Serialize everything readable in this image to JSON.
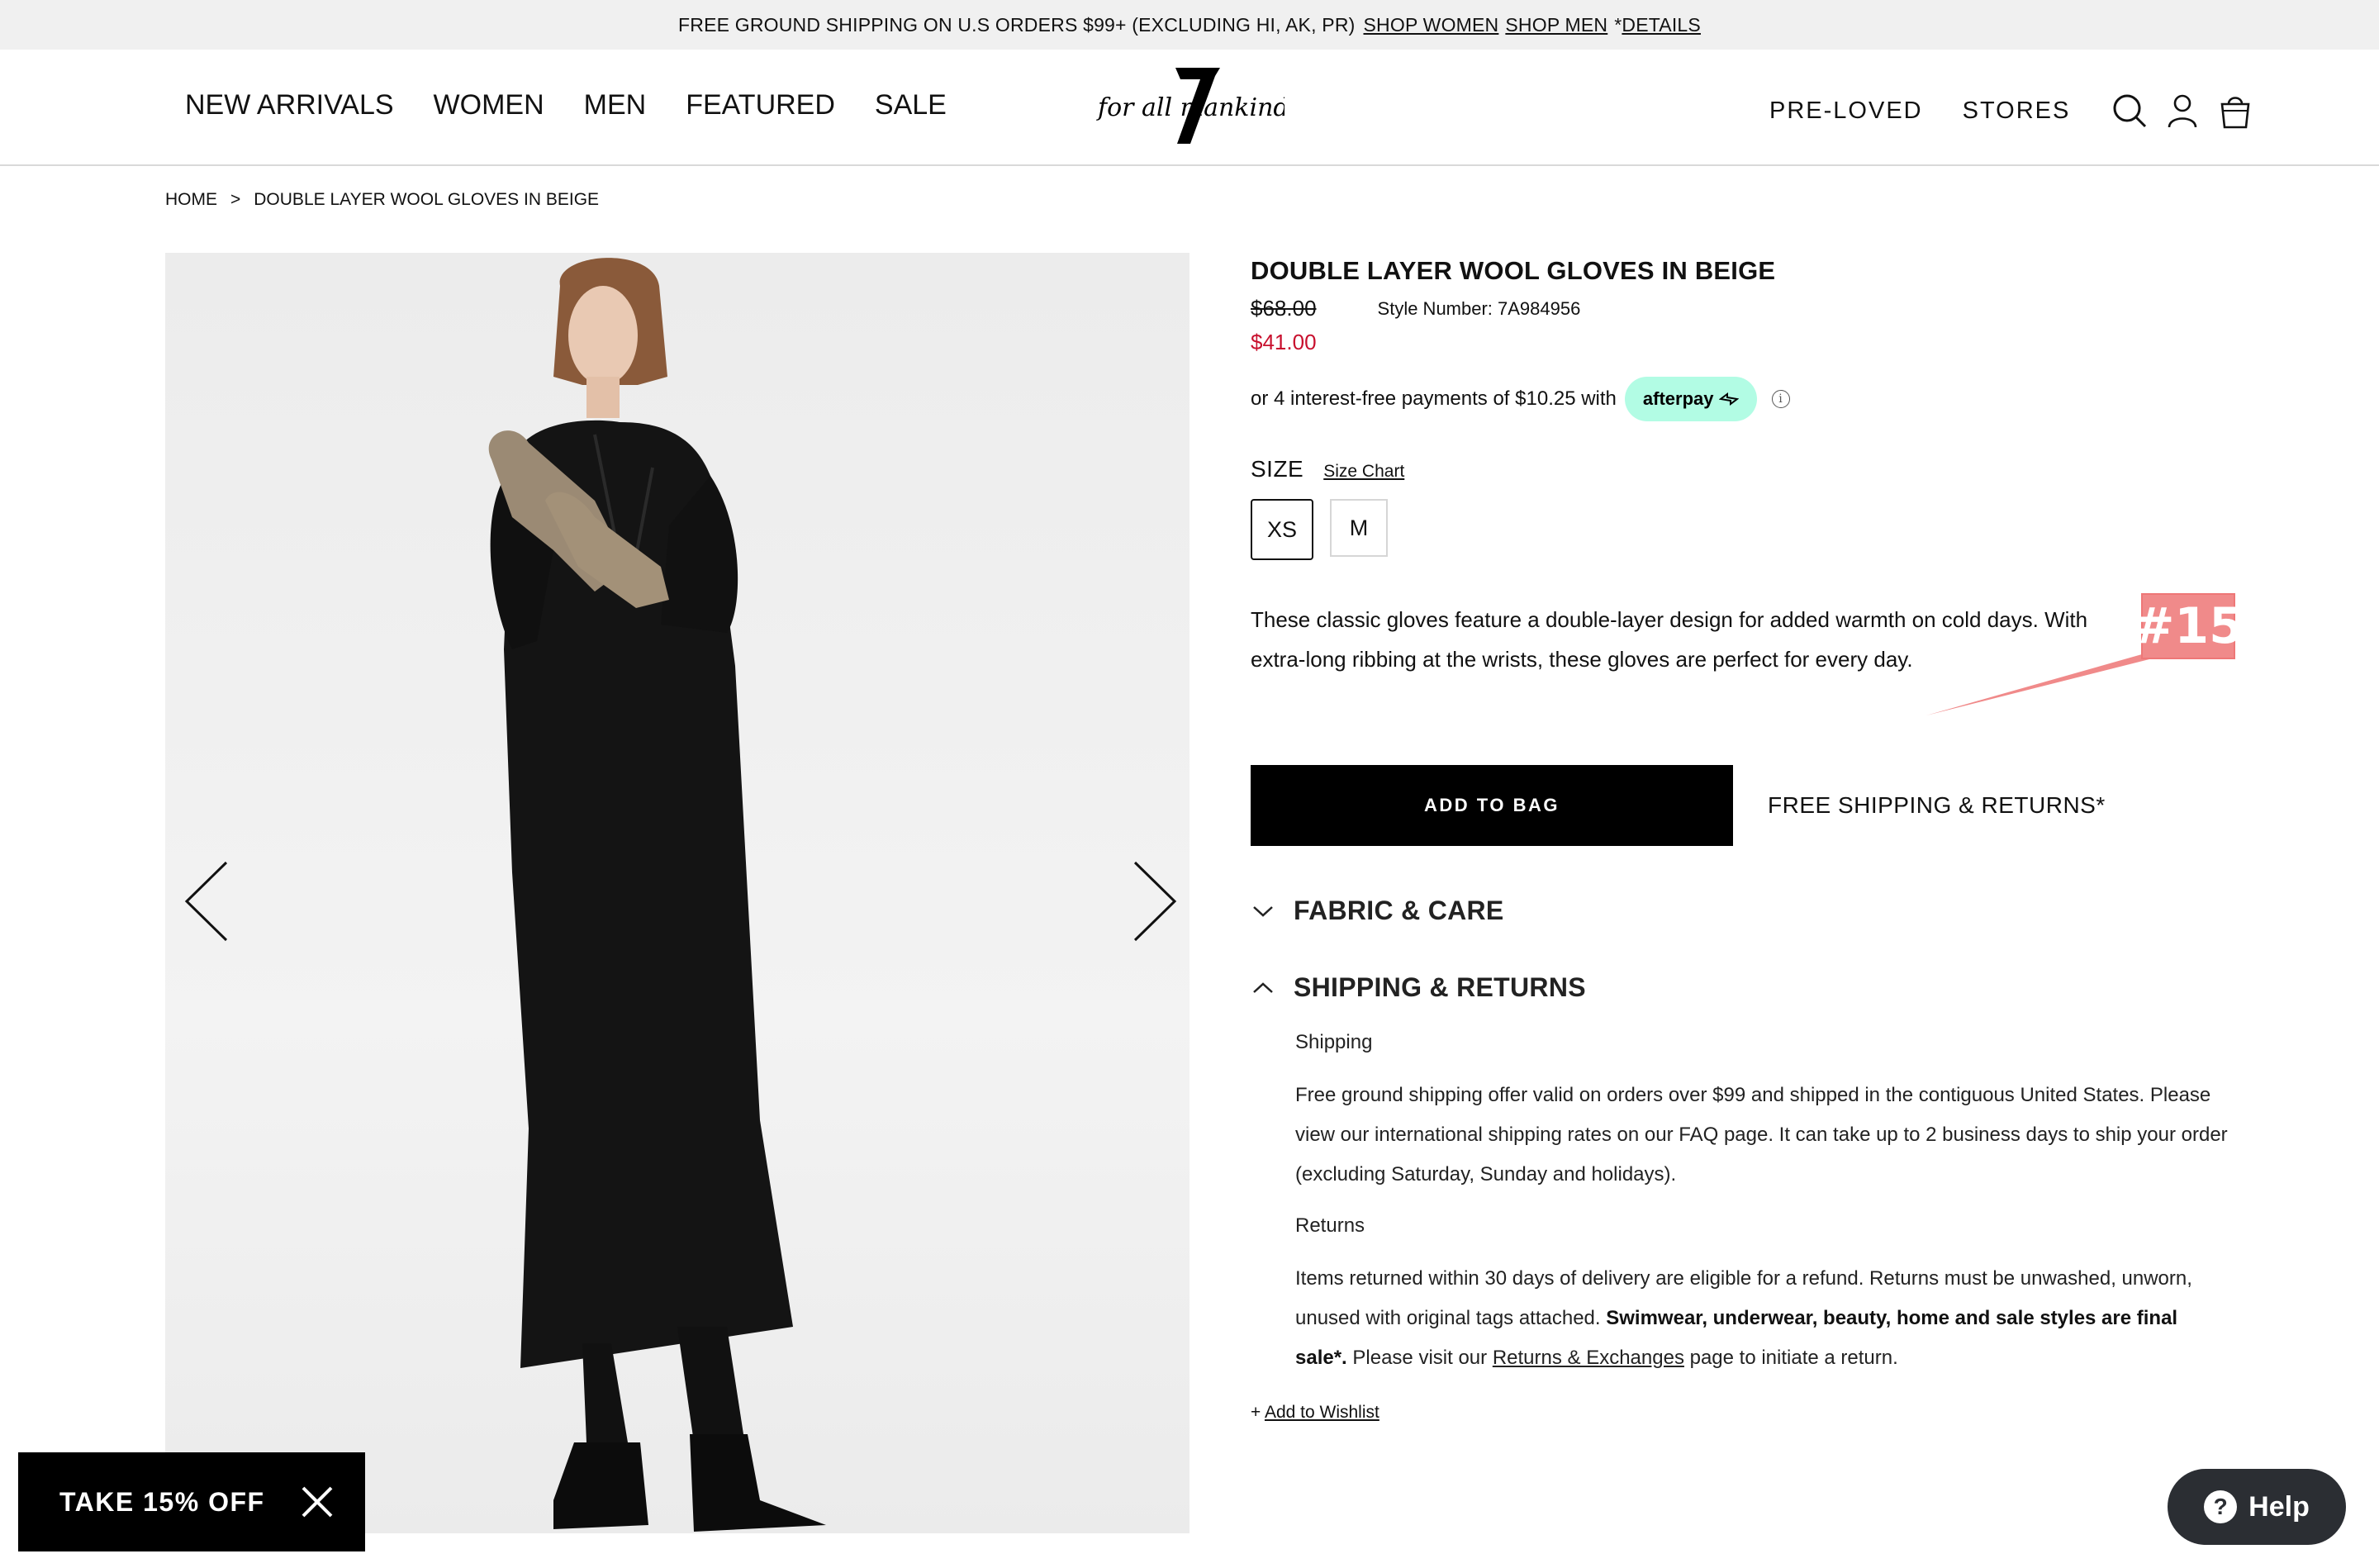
{
  "promo_bar": {
    "text": "FREE GROUND SHIPPING ON U.S ORDERS $99+ (EXCLUDING HI, AK, PR)",
    "shop_women": "SHOP WOMEN",
    "shop_men": "SHOP MEN",
    "details_prefix": "*",
    "details": "DETAILS"
  },
  "header": {
    "nav": [
      "NEW ARRIVALS",
      "WOMEN",
      "MEN",
      "FEATURED",
      "SALE"
    ],
    "logo_text": "for all mankind",
    "right_nav": [
      "PRE-LOVED",
      "STORES"
    ],
    "icons": [
      "search-icon",
      "account-icon",
      "bag-icon"
    ]
  },
  "breadcrumb": {
    "home": "HOME",
    "separator": ">",
    "current": "DOUBLE LAYER WOOL GLOVES IN BEIGE"
  },
  "product": {
    "title": "DOUBLE LAYER WOOL GLOVES IN BEIGE",
    "original_price": "$68.00",
    "style_number": "Style Number: 7A984956",
    "sale_price": "$41.00",
    "afterpay_text": "or 4 interest-free payments of $10.25 with",
    "afterpay_badge": "afterpay",
    "size_label": "SIZE",
    "size_chart": "Size Chart",
    "sizes": [
      "XS",
      "M"
    ],
    "selected_size": "XS",
    "description": "These classic gloves feature a double-layer design for added warmth on cold days. With extra-long ribbing at the wrists, these gloves are perfect for every day.",
    "add_to_bag": "ADD TO BAG",
    "free_shipping": "FREE SHIPPING & RETURNS*",
    "sale_color": "#c8102e"
  },
  "accordion": {
    "fabric_care": "FABRIC & CARE",
    "shipping_returns": "SHIPPING & RETURNS",
    "shipping_heading": "Shipping",
    "shipping_text": "Free ground shipping offer valid on orders over $99 and shipped in the contiguous United States. Please view our international shipping rates on our FAQ page. It can take up to 2 business days to ship your order (excluding Saturday, Sunday and holidays).",
    "returns_heading": "Returns",
    "returns_text_1": "Items returned within 30 days of delivery are eligible for a refund. Returns must be unwashed, unworn, unused with original tags attached.",
    "returns_bold": "Swimwear, underwear, beauty, home and sale styles are final sale*.",
    "returns_text_2": "Please visit our",
    "returns_link": "Returns & Exchanges",
    "returns_text_3": "page to initiate a return."
  },
  "wishlist": {
    "prefix": "+",
    "label": "Add to Wishlist"
  },
  "annotation": {
    "tag": "#15",
    "color": "#f08a8a"
  },
  "offer_popup": {
    "label": "TAKE 15% OFF"
  },
  "help_button": {
    "label": "Help"
  }
}
